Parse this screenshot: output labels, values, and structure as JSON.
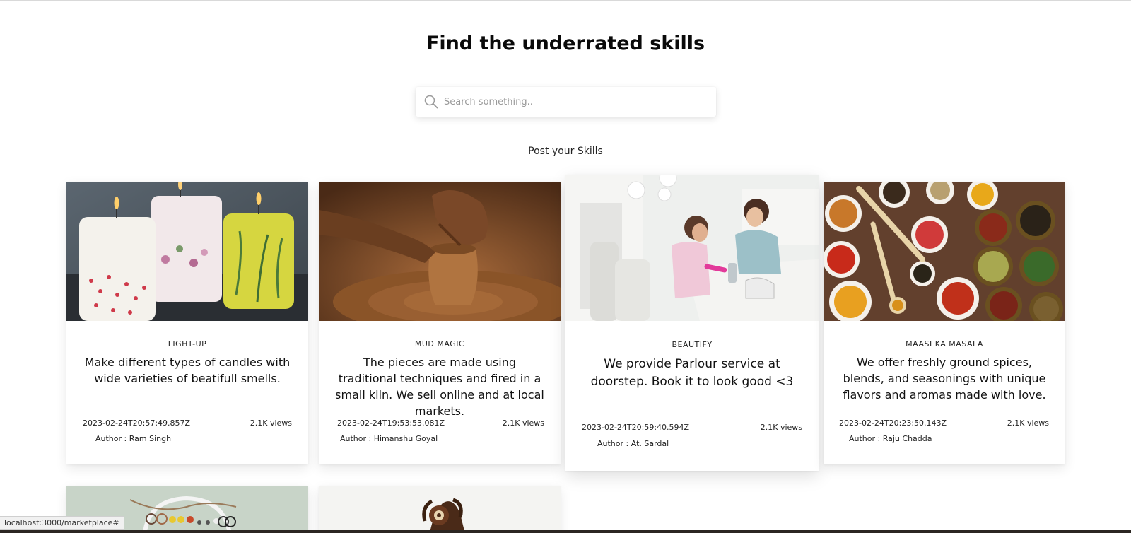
{
  "page": {
    "title": "Find the underrated skills",
    "search_placeholder": "Search something..",
    "post_link": "Post your Skills"
  },
  "cards": [
    {
      "category": "LIGHT-UP",
      "description": "Make different types of candles with wide varieties of beatifull smells.",
      "date": "2023-02-24T20:57:49.857Z",
      "views": "2.1K views",
      "author": "Author : Ram Singh",
      "image": "candles-image"
    },
    {
      "category": "MUD MAGIC",
      "description": "The pieces are made using traditional techniques and fired in a small kiln. We sell online and at local markets.",
      "date": "2023-02-24T19:53:53.081Z",
      "views": "2.1K views",
      "author": "Author : Himanshu Goyal",
      "image": "pottery-image"
    },
    {
      "category": "BEAUTIFY",
      "description": "We provide Parlour service at doorstep. Book it to look good <3",
      "date": "2023-02-24T20:59:40.594Z",
      "views": "2.1K views",
      "author": "Author : At. Sardal",
      "image": "parlour-image"
    },
    {
      "category": "MAASI KA MASALA",
      "description": "We offer freshly ground spices, blends, and seasonings with unique flavors and aromas made with love.",
      "date": "2023-02-24T20:23:50.143Z",
      "views": "2.1K views",
      "author": "Author : Raju Chadda",
      "image": "spices-image"
    }
  ],
  "status_bar": {
    "url": "localhost:3000/marketplace#"
  },
  "colors": {
    "background": "#ffffff",
    "text": "#111111",
    "placeholder": "#9a9a9a"
  }
}
